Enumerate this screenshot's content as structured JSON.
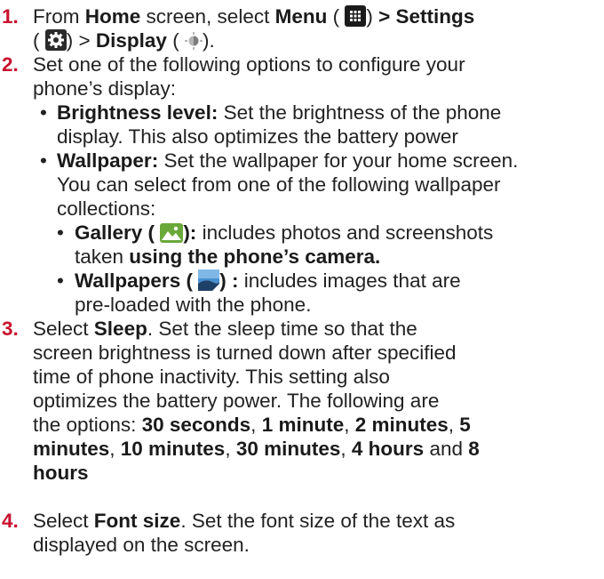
{
  "steps": [
    {
      "number": "1.",
      "parts": {
        "a": "From ",
        "b": "Home",
        "c": " screen, select ",
        "d": "Menu",
        "e": " (",
        "f": ") ",
        "g": "> Settings",
        "h": "(",
        "i": ") > ",
        "j": "Display",
        "k": " (",
        "l": ")."
      }
    },
    {
      "number": "2.",
      "line1": "Set one of the following options to configure your",
      "line2": "phone’s display:",
      "bullets": [
        {
          "label": "Brightness level:",
          "rest": " Set the brightness of the phone",
          "line2": "display. This also optimizes the battery power"
        },
        {
          "label": "Wallpaper:",
          "rest": "  Set the wallpaper for your home screen.",
          "line2": "You can select from one of the following wallpaper",
          "line3": "collections:",
          "subs": [
            {
              "label": "Gallery (",
              "label_end": "):",
              "rest": " includes photos and screenshots",
              "line2_plain": "taken ",
              "line2_bold": "using the phone’s camera."
            },
            {
              "label": "Wallpapers (",
              "label_end": ") :",
              "rest": " includes images that are",
              "line2": "pre-loaded with the phone."
            }
          ]
        }
      ]
    },
    {
      "number": "3.",
      "l1a": "Select ",
      "l1b": "Sleep",
      "l1c": ". Set the sleep time so that the",
      "l2": "screen brightness is turned down after specified",
      "l3": "time of phone inactivity. This setting also",
      "l4": "optimizes the battery power. The following are",
      "l5a": "the options: ",
      "o1": "30 seconds",
      "sep1": ", ",
      "o2": "1 minute",
      "sep2": ", ",
      "o3": "2 minutes",
      "sep3": ", ",
      "o4a": "5",
      "o4b": "minutes",
      "sep4": ", ",
      "o5": "10 minutes",
      "sep5": ", ",
      "o6": "30 minutes",
      "sep6": ", ",
      "o7": "4 hours",
      "and": " and ",
      "o8a": "8",
      "o8b": "hours"
    },
    {
      "number": "4.",
      "l1a": "Select ",
      "l1b": "Font size",
      "l1c": ". Set the font size of the text as",
      "l2": "displayed on the screen."
    }
  ],
  "icons": {
    "menu": "menu-grid-icon",
    "settings": "gear-icon",
    "display": "display-brightness-icon",
    "gallery": "gallery-photo-icon",
    "wallpapers": "wallpaper-image-icon"
  },
  "colors": {
    "step_number": "#c8102e",
    "text": "#222222"
  }
}
